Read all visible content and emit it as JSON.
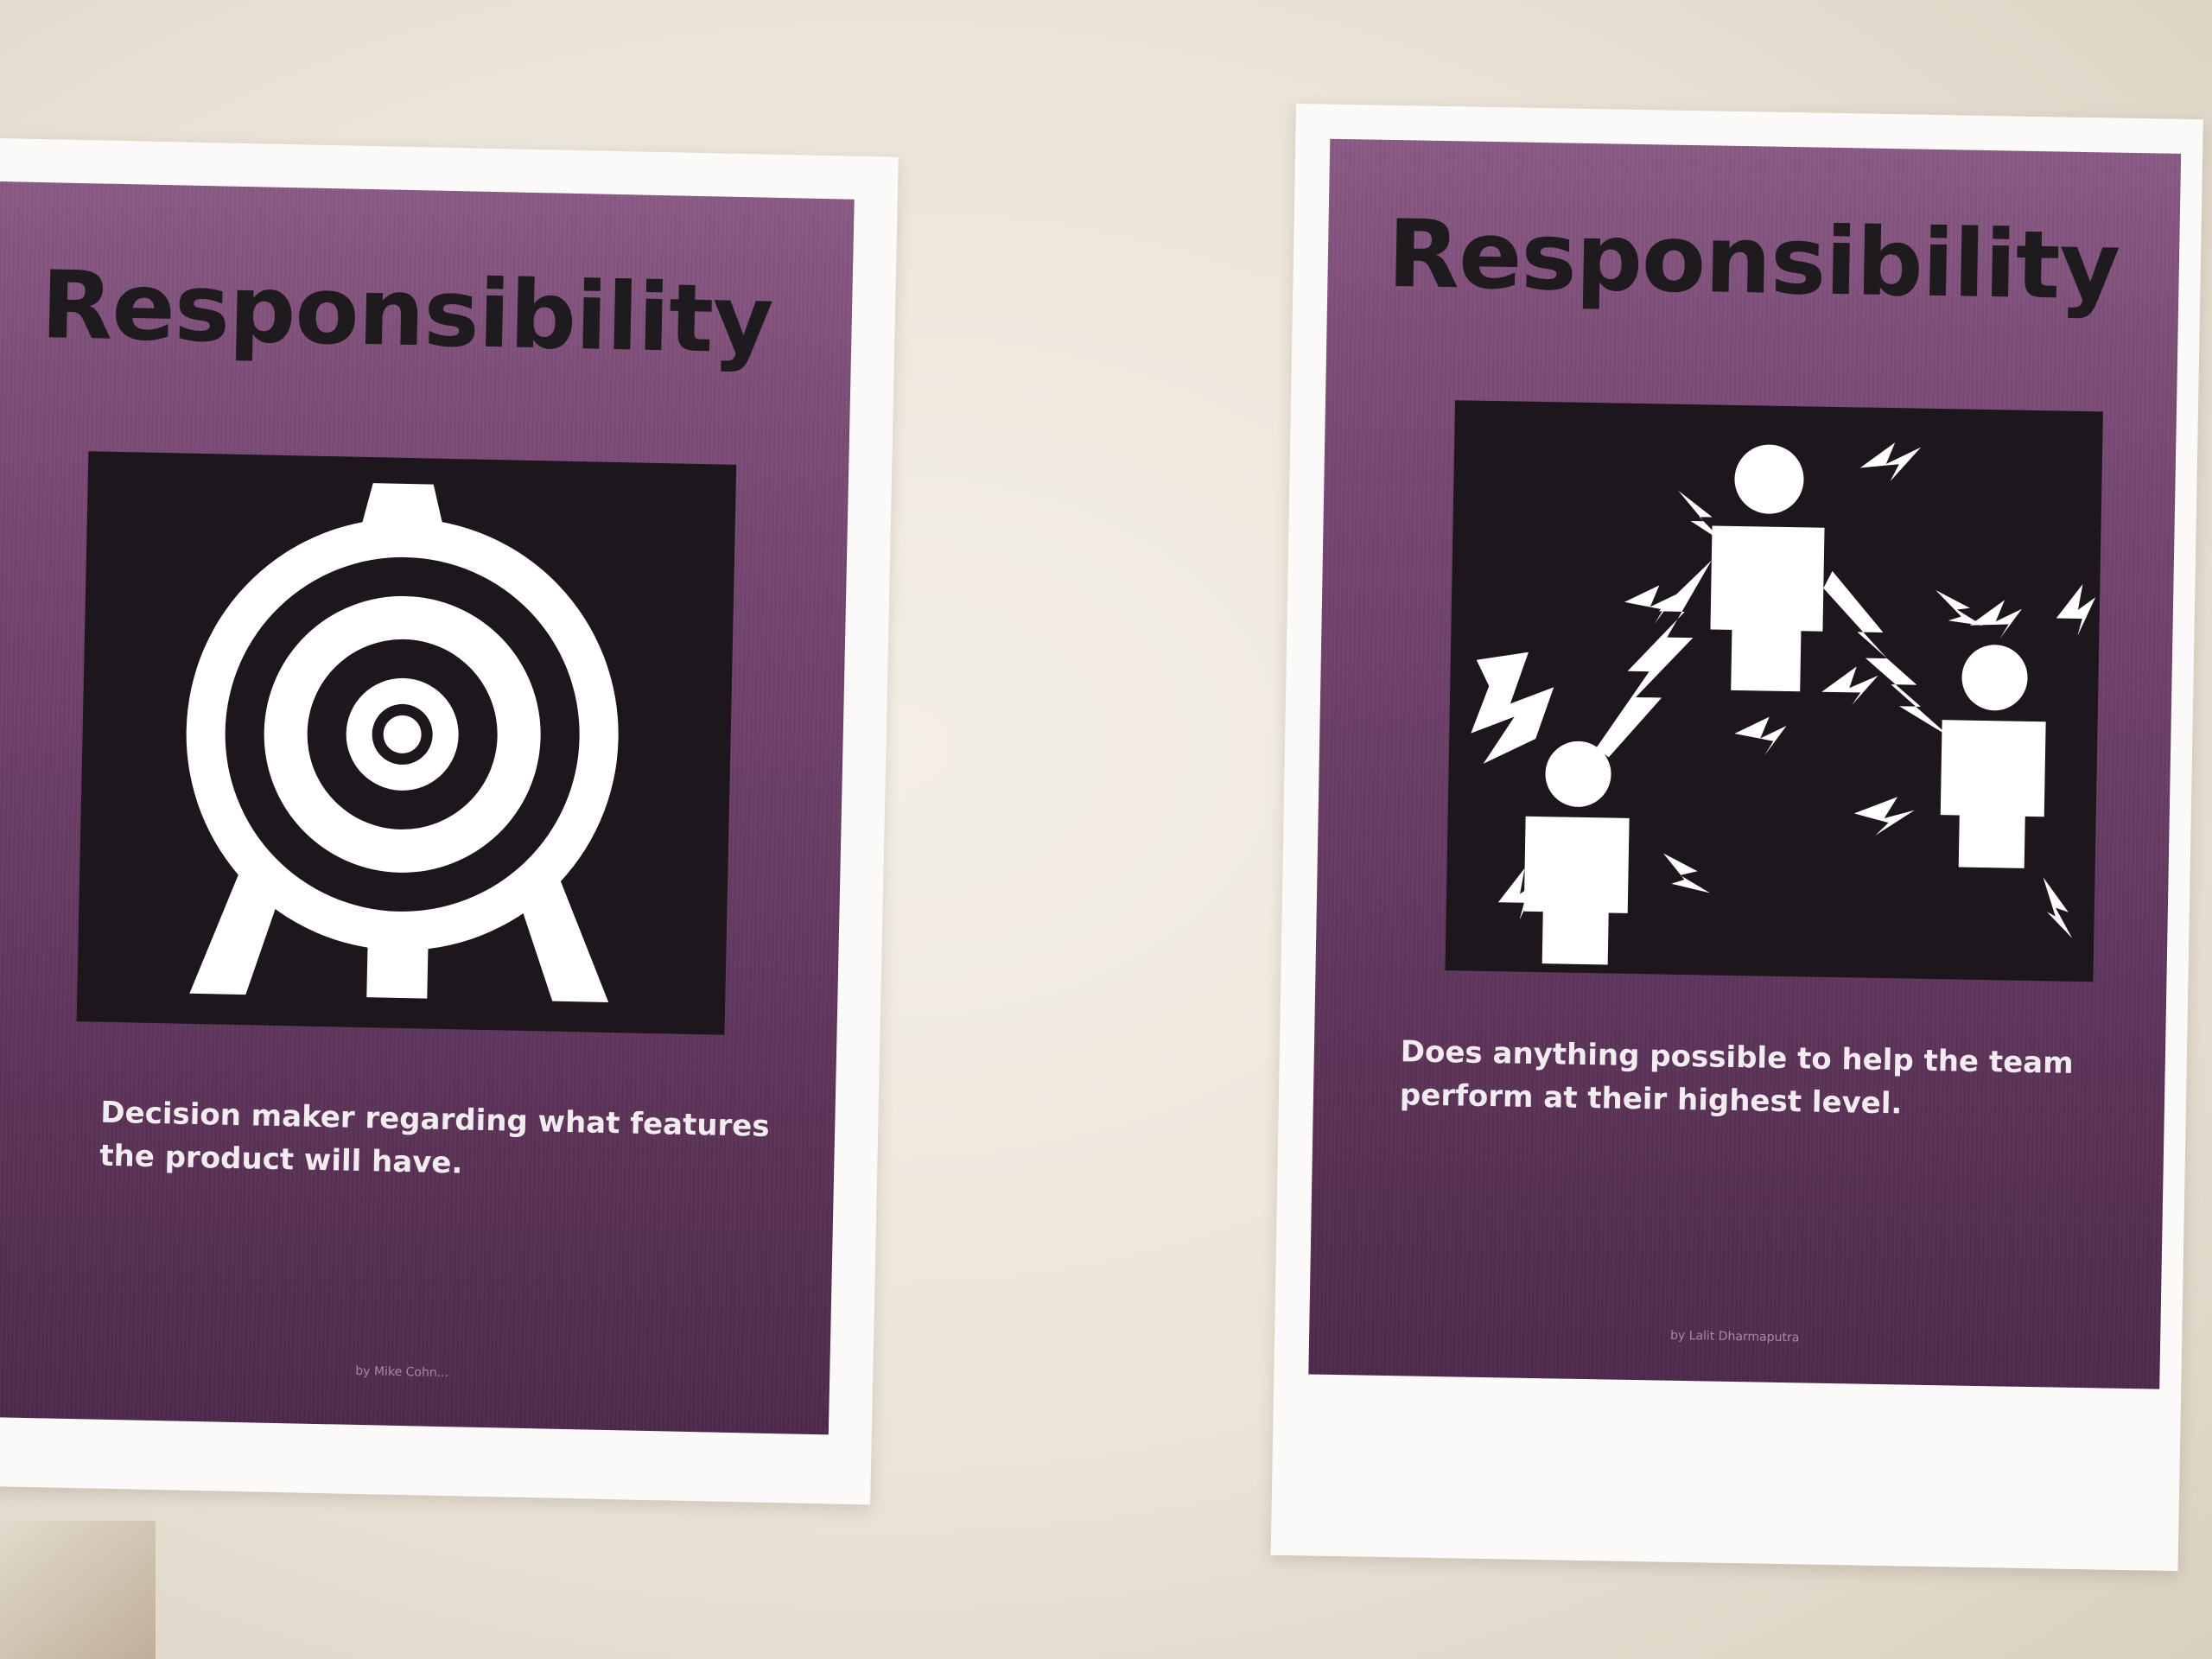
{
  "posters": [
    {
      "title": "Responsibility",
      "icon": "target-on-easel-icon",
      "description": "Decision maker regarding what features the product will have.",
      "credit": "by Mike Cohn..."
    },
    {
      "title": "Responsibility",
      "icon": "team-with-lightning-icon",
      "description": "Does anything possible to help the team perform at their highest level.",
      "credit": "by Lalit Dharmaputra"
    }
  ],
  "colors": {
    "poster_purple": "#6d4069",
    "icon_background": "#1d161c",
    "title_text": "#1e1a1e",
    "wall": "#ebe4d8",
    "paper": "#fbfaf8"
  }
}
